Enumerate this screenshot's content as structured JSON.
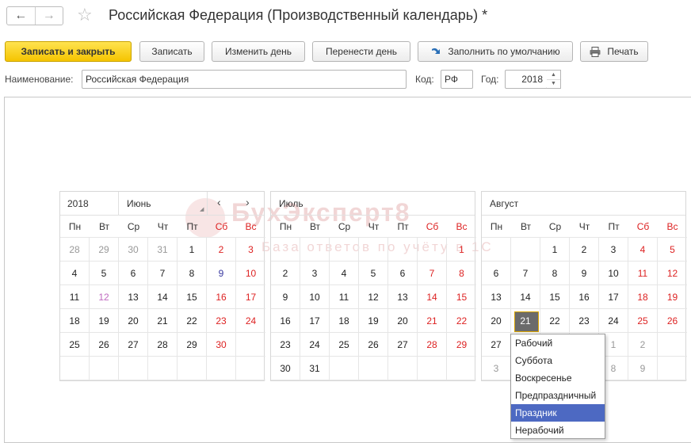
{
  "window": {
    "title": "Российская Федерация (Производственный календарь) *",
    "back_icon": "←",
    "forward_icon": "→",
    "favorite_icon": "☆"
  },
  "toolbar": {
    "save_close": "Записать и закрыть",
    "save": "Записать",
    "change_day": "Изменить день",
    "move_day": "Перенести день",
    "fill_default": "Заполнить по умолчанию",
    "print": "Печать"
  },
  "form": {
    "name_label": "Наименование:",
    "name_value": "Российская Федерация",
    "code_label": "Код:",
    "code_value": "РФ",
    "year_label": "Год:",
    "year_value": "2018"
  },
  "watermark": {
    "line1": "БухЭксперт8",
    "line2": "База ответов по учёту в 1С"
  },
  "weekdays": [
    "Пн",
    "Вт",
    "Ср",
    "Чт",
    "Пт",
    "Сб",
    "Вс"
  ],
  "months": [
    {
      "year": "2018",
      "name": "Июнь",
      "prev_icon": "‹",
      "next_icon": "›",
      "cells": [
        {
          "d": "28",
          "s": "muted"
        },
        {
          "d": "29",
          "s": "muted"
        },
        {
          "d": "30",
          "s": "muted"
        },
        {
          "d": "31",
          "s": "muted"
        },
        {
          "d": "1",
          "s": ""
        },
        {
          "d": "2",
          "s": "red"
        },
        {
          "d": "3",
          "s": "red"
        },
        {
          "d": "4",
          "s": ""
        },
        {
          "d": "5",
          "s": ""
        },
        {
          "d": "6",
          "s": ""
        },
        {
          "d": "7",
          "s": ""
        },
        {
          "d": "8",
          "s": ""
        },
        {
          "d": "9",
          "s": "blue"
        },
        {
          "d": "10",
          "s": "red"
        },
        {
          "d": "11",
          "s": ""
        },
        {
          "d": "12",
          "s": "pink"
        },
        {
          "d": "13",
          "s": ""
        },
        {
          "d": "14",
          "s": ""
        },
        {
          "d": "15",
          "s": ""
        },
        {
          "d": "16",
          "s": "red"
        },
        {
          "d": "17",
          "s": "red"
        },
        {
          "d": "18",
          "s": ""
        },
        {
          "d": "19",
          "s": ""
        },
        {
          "d": "20",
          "s": ""
        },
        {
          "d": "21",
          "s": ""
        },
        {
          "d": "22",
          "s": ""
        },
        {
          "d": "23",
          "s": "red"
        },
        {
          "d": "24",
          "s": "red"
        },
        {
          "d": "25",
          "s": ""
        },
        {
          "d": "26",
          "s": ""
        },
        {
          "d": "27",
          "s": ""
        },
        {
          "d": "28",
          "s": ""
        },
        {
          "d": "29",
          "s": ""
        },
        {
          "d": "30",
          "s": "red"
        },
        {
          "d": "",
          "s": ""
        },
        {
          "d": "",
          "s": ""
        },
        {
          "d": "",
          "s": ""
        },
        {
          "d": "",
          "s": ""
        },
        {
          "d": "",
          "s": ""
        },
        {
          "d": "",
          "s": ""
        },
        {
          "d": "",
          "s": ""
        },
        {
          "d": "",
          "s": ""
        }
      ]
    },
    {
      "name": "Июль",
      "cells": [
        {
          "d": "",
          "s": ""
        },
        {
          "d": "",
          "s": ""
        },
        {
          "d": "",
          "s": ""
        },
        {
          "d": "",
          "s": ""
        },
        {
          "d": "",
          "s": ""
        },
        {
          "d": "",
          "s": ""
        },
        {
          "d": "1",
          "s": "red"
        },
        {
          "d": "2",
          "s": ""
        },
        {
          "d": "3",
          "s": ""
        },
        {
          "d": "4",
          "s": ""
        },
        {
          "d": "5",
          "s": ""
        },
        {
          "d": "6",
          "s": ""
        },
        {
          "d": "7",
          "s": "red"
        },
        {
          "d": "8",
          "s": "red"
        },
        {
          "d": "9",
          "s": ""
        },
        {
          "d": "10",
          "s": ""
        },
        {
          "d": "11",
          "s": ""
        },
        {
          "d": "12",
          "s": ""
        },
        {
          "d": "13",
          "s": ""
        },
        {
          "d": "14",
          "s": "red"
        },
        {
          "d": "15",
          "s": "red"
        },
        {
          "d": "16",
          "s": ""
        },
        {
          "d": "17",
          "s": ""
        },
        {
          "d": "18",
          "s": ""
        },
        {
          "d": "19",
          "s": ""
        },
        {
          "d": "20",
          "s": ""
        },
        {
          "d": "21",
          "s": "red"
        },
        {
          "d": "22",
          "s": "red"
        },
        {
          "d": "23",
          "s": ""
        },
        {
          "d": "24",
          "s": ""
        },
        {
          "d": "25",
          "s": ""
        },
        {
          "d": "26",
          "s": ""
        },
        {
          "d": "27",
          "s": ""
        },
        {
          "d": "28",
          "s": "red"
        },
        {
          "d": "29",
          "s": "red"
        },
        {
          "d": "30",
          "s": ""
        },
        {
          "d": "31",
          "s": ""
        },
        {
          "d": "",
          "s": ""
        },
        {
          "d": "",
          "s": ""
        },
        {
          "d": "",
          "s": ""
        },
        {
          "d": "",
          "s": ""
        },
        {
          "d": "",
          "s": ""
        }
      ]
    },
    {
      "name": "Август",
      "cells": [
        {
          "d": "",
          "s": ""
        },
        {
          "d": "",
          "s": ""
        },
        {
          "d": "1",
          "s": ""
        },
        {
          "d": "2",
          "s": ""
        },
        {
          "d": "3",
          "s": ""
        },
        {
          "d": "4",
          "s": "red"
        },
        {
          "d": "5",
          "s": "red"
        },
        {
          "d": "6",
          "s": ""
        },
        {
          "d": "7",
          "s": ""
        },
        {
          "d": "8",
          "s": ""
        },
        {
          "d": "9",
          "s": ""
        },
        {
          "d": "10",
          "s": ""
        },
        {
          "d": "11",
          "s": "red"
        },
        {
          "d": "12",
          "s": "red"
        },
        {
          "d": "13",
          "s": ""
        },
        {
          "d": "14",
          "s": ""
        },
        {
          "d": "15",
          "s": ""
        },
        {
          "d": "16",
          "s": ""
        },
        {
          "d": "17",
          "s": ""
        },
        {
          "d": "18",
          "s": "red"
        },
        {
          "d": "19",
          "s": "red"
        },
        {
          "d": "20",
          "s": ""
        },
        {
          "d": "21",
          "s": "sel"
        },
        {
          "d": "22",
          "s": ""
        },
        {
          "d": "23",
          "s": ""
        },
        {
          "d": "24",
          "s": ""
        },
        {
          "d": "25",
          "s": "red"
        },
        {
          "d": "26",
          "s": "red"
        },
        {
          "d": "27",
          "s": ""
        },
        {
          "d": "",
          "s": ""
        },
        {
          "d": "",
          "s": ""
        },
        {
          "d": "31",
          "s": ""
        },
        {
          "d": "1",
          "s": "muted"
        },
        {
          "d": "2",
          "s": "muted"
        },
        {
          "d": "",
          "s": ""
        },
        {
          "d": "3",
          "s": "muted"
        },
        {
          "d": "",
          "s": ""
        },
        {
          "d": "",
          "s": ""
        },
        {
          "d": "7",
          "s": "muted"
        },
        {
          "d": "8",
          "s": "muted"
        },
        {
          "d": "9",
          "s": "muted"
        },
        {
          "d": "",
          "s": ""
        }
      ]
    }
  ],
  "day_type_menu": [
    "Рабочий",
    "Суббота",
    "Воскресенье",
    "Предпраздничный",
    "Праздник",
    "Нерабочий"
  ],
  "day_type_menu_highlighted": "Праздник"
}
